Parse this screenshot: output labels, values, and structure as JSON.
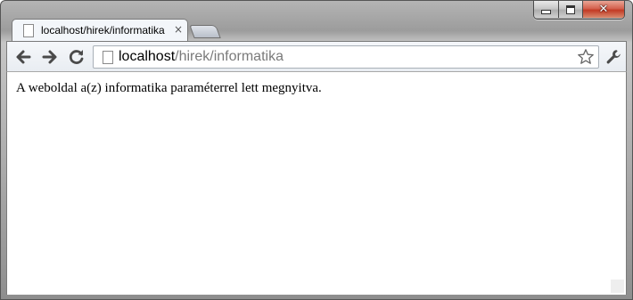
{
  "window": {
    "controls": [
      "minimize-icon",
      "maximize-icon",
      "close-icon"
    ],
    "close_glyph": "✕"
  },
  "tabs": [
    {
      "title": "localhost/hirek/informatika",
      "close_glyph": "×",
      "icon": "page-icon"
    }
  ],
  "toolbar": {
    "back_icon": "arrow-left-icon",
    "forward_icon": "arrow-right-icon",
    "reload_icon": "reload-icon",
    "bookmark_icon": "star-icon",
    "menu_icon": "wrench-icon"
  },
  "omnibox": {
    "host": "localhost",
    "path": "/hirek/informatika"
  },
  "page": {
    "body_text": "A weboldal a(z) informatika paraméterrel lett megnyitva."
  },
  "colors": {
    "window_frame": "#9c9c9c",
    "close_button": "#c23a24",
    "url_path": "#7a7a7a"
  }
}
